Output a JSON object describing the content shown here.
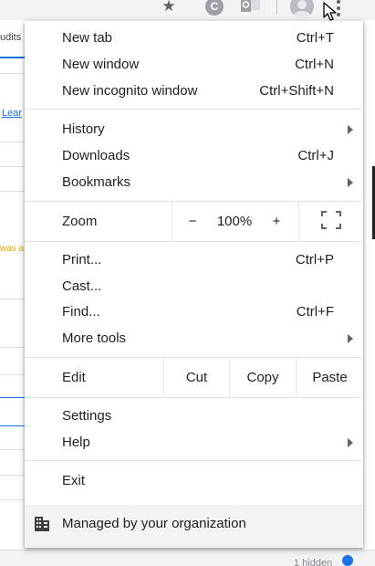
{
  "background": {
    "tab_label": "udits",
    "link_text": "Lear",
    "warning_text": "was a",
    "status_text": "1 hidden",
    "extension_letter": "C"
  },
  "icons": {
    "star": "star-icon",
    "extension_c": "extension-c-icon",
    "extension_o": "outlook-extension-icon",
    "avatar": "avatar-icon",
    "menu": "kebab-menu-icon",
    "fullscreen": "fullscreen-icon",
    "building": "building-icon",
    "cursor": "mouse-cursor-icon"
  },
  "colors": {
    "accent": "#1a73e8",
    "text": "#202124",
    "icon": "#5f6368",
    "managed_bg": "#f1f3f4"
  },
  "menu": {
    "new_tab": {
      "label": "New tab",
      "shortcut": "Ctrl+T"
    },
    "new_window": {
      "label": "New window",
      "shortcut": "Ctrl+N"
    },
    "new_incognito": {
      "label": "New incognito window",
      "shortcut": "Ctrl+Shift+N"
    },
    "history": {
      "label": "History"
    },
    "downloads": {
      "label": "Downloads",
      "shortcut": "Ctrl+J"
    },
    "bookmarks": {
      "label": "Bookmarks"
    },
    "zoom": {
      "label": "Zoom",
      "minus": "−",
      "value": "100%",
      "plus": "+"
    },
    "print": {
      "label": "Print...",
      "shortcut": "Ctrl+P"
    },
    "cast": {
      "label": "Cast..."
    },
    "find": {
      "label": "Find...",
      "shortcut": "Ctrl+F"
    },
    "more_tools": {
      "label": "More tools"
    },
    "edit": {
      "label": "Edit",
      "cut": "Cut",
      "copy": "Copy",
      "paste": "Paste"
    },
    "settings": {
      "label": "Settings"
    },
    "help": {
      "label": "Help"
    },
    "exit": {
      "label": "Exit"
    },
    "managed": {
      "label": "Managed by your organization"
    }
  }
}
